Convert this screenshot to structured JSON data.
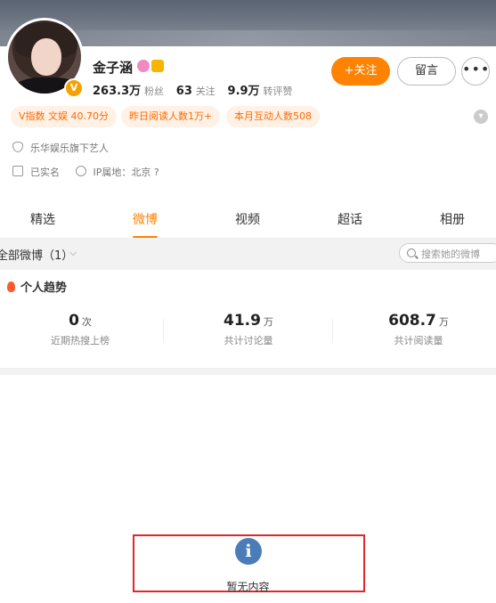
{
  "profile": {
    "name": "金子涵",
    "followers_count": "263.3万",
    "followers_label": "粉丝",
    "following_count": "63",
    "following_label": "关注",
    "likes_count": "9.9万",
    "likes_label": "转评赞"
  },
  "actions": {
    "follow_label": "+关注",
    "message_label": "留言",
    "more_label": "•••"
  },
  "tags": [
    "V指数 文娱 40.70分",
    "昨日阅读人数1万+",
    "本月互动人数508"
  ],
  "info": {
    "agency": "乐华娱乐旗下艺人",
    "verified": "已实名",
    "ip_location": "IP属地：北京 ?"
  },
  "tabs": [
    "精选",
    "微博",
    "视频",
    "超话",
    "相册"
  ],
  "active_tab": "微博",
  "filter": {
    "label": "全部微博（1）",
    "search_placeholder": "搜索她的微博"
  },
  "trend": {
    "title": "个人趋势",
    "stats": [
      {
        "value": "0",
        "unit": "次",
        "caption": "近期热搜上榜"
      },
      {
        "value": "41.9",
        "unit": "万",
        "caption": "共计讨论量"
      },
      {
        "value": "608.7",
        "unit": "万",
        "caption": "共计阅读量"
      }
    ]
  },
  "empty_state": {
    "message": "暂无内容"
  },
  "colors": {
    "accent": "#ff8200",
    "tag_bg": "#fff1e6",
    "highlight_border": "#e0282a",
    "info_icon": "#4a7db8"
  }
}
